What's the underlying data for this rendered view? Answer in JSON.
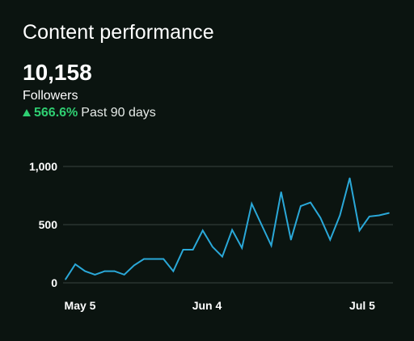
{
  "header": {
    "title": "Content performance",
    "metric_value": "10,158",
    "metric_label": "Followers",
    "change_value": "566.6%",
    "change_period": "Past 90 days",
    "change_icon": "triangle-up-icon",
    "change_color": "#2fcf72"
  },
  "colors": {
    "background": "#0b1410",
    "line": "#2aa8d8",
    "grid": "#3a4440"
  },
  "chart_data": {
    "type": "line",
    "title": "",
    "xlabel": "",
    "ylabel": "",
    "x_tick_labels": [
      "May 5",
      "Jun 4",
      "Jul 5"
    ],
    "y_tick_labels": [
      "0",
      "500",
      "1,000"
    ],
    "y_ticks": [
      0,
      500,
      1000
    ],
    "ylim": [
      0,
      1000
    ],
    "grid": true,
    "series": [
      {
        "values": [
          30,
          160,
          100,
          70,
          100,
          100,
          70,
          150,
          205,
          205,
          205,
          100,
          285,
          285,
          450,
          310,
          225,
          455,
          300,
          680,
          500,
          320,
          780,
          370,
          660,
          690,
          560,
          370,
          580,
          900,
          450,
          570,
          580,
          600
        ]
      }
    ]
  }
}
